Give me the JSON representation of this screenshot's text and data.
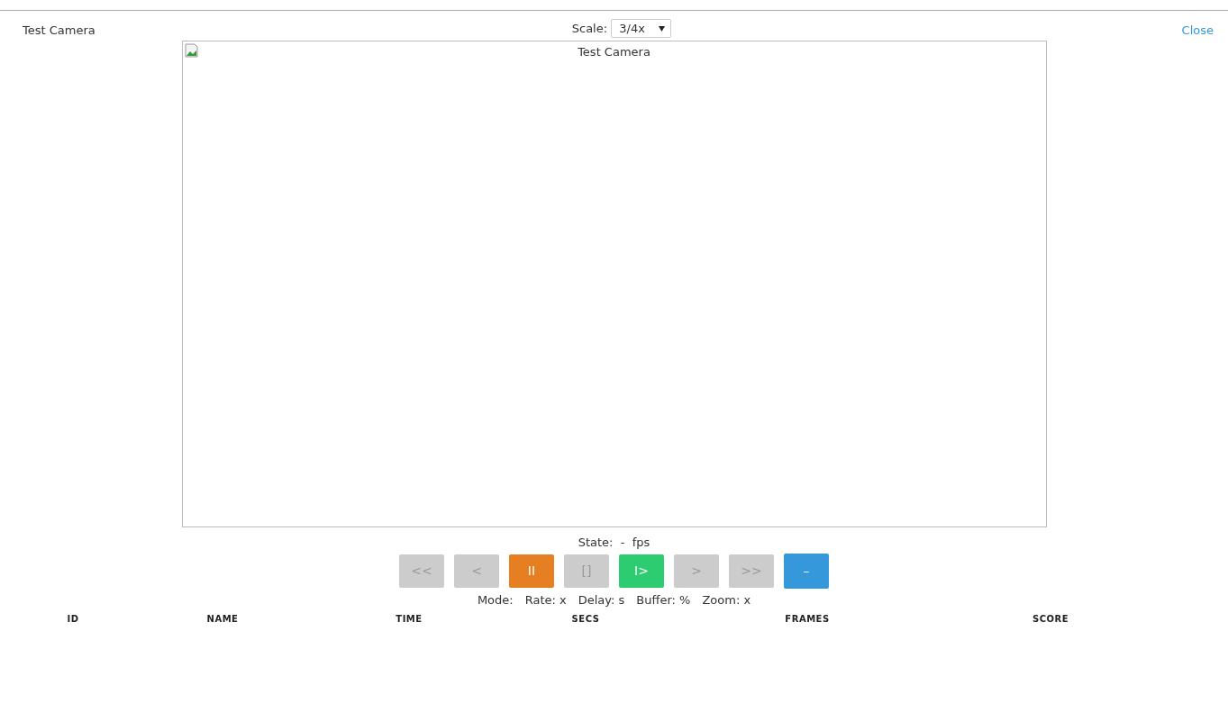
{
  "header": {
    "title": "Test Camera",
    "scale_label": "Scale:",
    "scale_value": "3/4x",
    "close": "Close"
  },
  "stream": {
    "alt_text": "Test Camera"
  },
  "status": {
    "state_label": "State:",
    "state_value": "-",
    "fps": "fps"
  },
  "controls": [
    {
      "label": "<<",
      "disabled": true,
      "color": "#cccccc"
    },
    {
      "label": "<",
      "disabled": true,
      "color": "#cccccc"
    },
    {
      "label": "II",
      "disabled": false,
      "color": "#e67e22"
    },
    {
      "label": "[]",
      "disabled": true,
      "color": "#cccccc"
    },
    {
      "label": "I>",
      "disabled": false,
      "color": "#2ecc71"
    },
    {
      "label": ">",
      "disabled": true,
      "color": "#cccccc"
    },
    {
      "label": ">>",
      "disabled": true,
      "color": "#cccccc"
    },
    {
      "label": "–",
      "disabled": false,
      "color": "#3498db"
    }
  ],
  "info": [
    "Mode:",
    "Rate: x",
    "Delay: s",
    "Buffer: %",
    "Zoom: x"
  ],
  "table": {
    "columns": [
      "ID",
      "NAME",
      "TIME",
      "SECS",
      "FRAMES",
      "SCORE"
    ]
  }
}
